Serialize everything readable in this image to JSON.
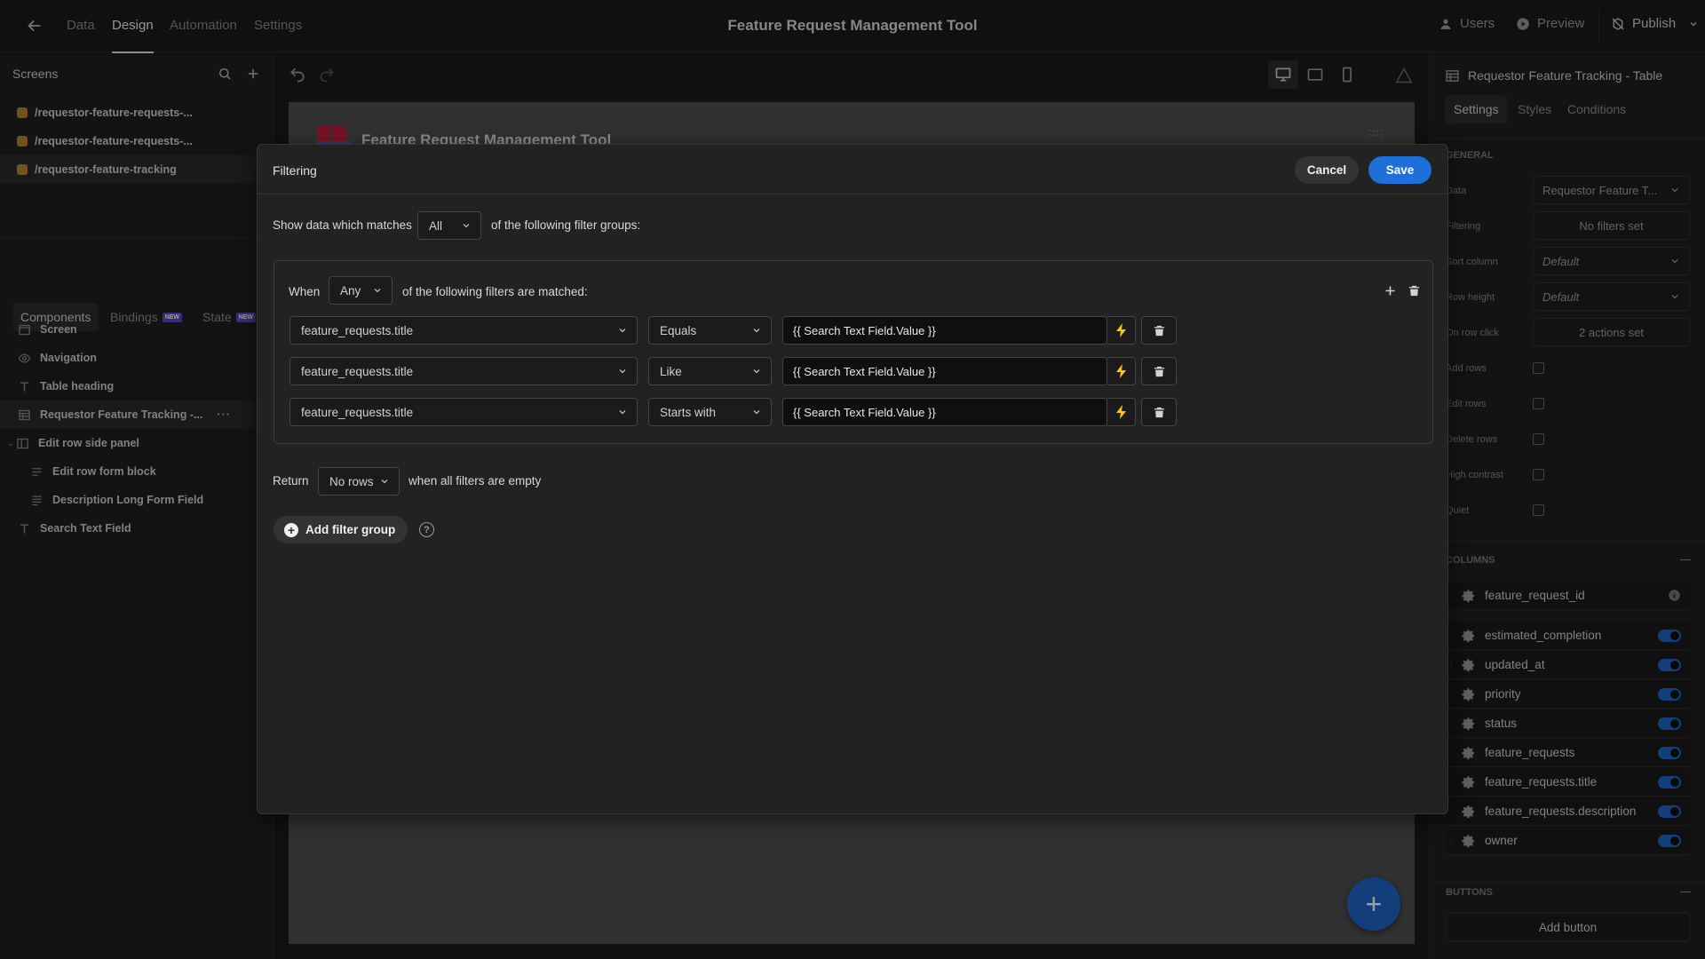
{
  "topbar": {
    "tabs": [
      "Data",
      "Design",
      "Automation",
      "Settings"
    ],
    "active_tab": "Design",
    "app_title": "Feature Request Management Tool",
    "users_label": "Users",
    "preview_label": "Preview",
    "publish_label": "Publish"
  },
  "left_panel": {
    "screens_heading": "Screens",
    "screens": [
      {
        "label": "/requestor-feature-requests-...",
        "active": false
      },
      {
        "label": "/requestor-feature-requests-...",
        "active": false
      },
      {
        "label": "/requestor-feature-tracking",
        "active": true
      }
    ],
    "tabs": {
      "components": "Components",
      "bindings": "Bindings",
      "state": "State",
      "new_badge": "NEW"
    },
    "components": [
      {
        "label": "Screen",
        "icon": "screen-icon"
      },
      {
        "label": "Navigation",
        "icon": "eye-icon"
      },
      {
        "label": "Table heading",
        "icon": "text-icon"
      },
      {
        "label": "Requestor Feature Tracking -...",
        "icon": "table-icon",
        "active": true
      },
      {
        "label": "Edit row side panel",
        "icon": "panel-icon"
      },
      {
        "label": "Edit row form block",
        "icon": "form-icon"
      },
      {
        "label": "Description Long Form Field",
        "icon": "longform-icon"
      },
      {
        "label": "Search Text Field",
        "icon": "text-icon"
      }
    ]
  },
  "canvas": {
    "title": "Feature Request Management Tool"
  },
  "right_panel": {
    "title": "Requestor Feature Tracking - Table",
    "tabs": [
      "Settings",
      "Styles",
      "Conditions"
    ],
    "general_label": "GENERAL",
    "settings": {
      "data": {
        "label": "Data",
        "value": "Requestor Feature T..."
      },
      "filtering": {
        "label": "Filtering",
        "value": "No filters set"
      },
      "sort_column": {
        "label": "Sort column",
        "value": "Default"
      },
      "row_height": {
        "label": "Row height",
        "value": "Default"
      },
      "on_row_click": {
        "label": "On row click",
        "value": "2 actions set"
      },
      "add_rows": {
        "label": "Add rows"
      },
      "edit_rows": {
        "label": "Edit rows"
      },
      "delete_rows": {
        "label": "Delete rows"
      },
      "high_contrast": {
        "label": "High contrast"
      },
      "quiet": {
        "label": "Quiet"
      }
    },
    "columns_label": "COLUMNS",
    "columns": [
      {
        "name": "feature_request_id",
        "toggle": false
      },
      {
        "name": "estimated_completion",
        "toggle": true
      },
      {
        "name": "updated_at",
        "toggle": true
      },
      {
        "name": "priority",
        "toggle": true
      },
      {
        "name": "status",
        "toggle": true
      },
      {
        "name": "feature_requests",
        "toggle": true
      },
      {
        "name": "feature_requests.title",
        "toggle": true
      },
      {
        "name": "feature_requests.description",
        "toggle": true
      },
      {
        "name": "owner",
        "toggle": true
      }
    ],
    "buttons_label": "BUTTONS",
    "add_button_label": "Add button"
  },
  "modal": {
    "title": "Filtering",
    "cancel_label": "Cancel",
    "save_label": "Save",
    "show_prefix": "Show data which matches",
    "match_mode": "All",
    "show_suffix": "of the following filter groups:",
    "group": {
      "when_label": "When",
      "group_mode": "Any",
      "matched_text": "of the following filters are matched:",
      "filters": [
        {
          "field": "feature_requests.title",
          "operator": "Equals",
          "value": "{{ Search Text Field.Value }}"
        },
        {
          "field": "feature_requests.title",
          "operator": "Like",
          "value": "{{ Search Text Field.Value }}"
        },
        {
          "field": "feature_requests.title",
          "operator": "Starts with",
          "value": "{{ Search Text Field.Value }}"
        }
      ]
    },
    "return_label": "Return",
    "return_value": "No rows",
    "return_suffix": "when all filters are empty",
    "add_group_label": "Add filter group",
    "help_glyph": "?"
  },
  "colors": {
    "accent_blue": "#1d6fd9",
    "bolt_yellow": "#f5c518",
    "screen_badge": "#b48a2a"
  }
}
